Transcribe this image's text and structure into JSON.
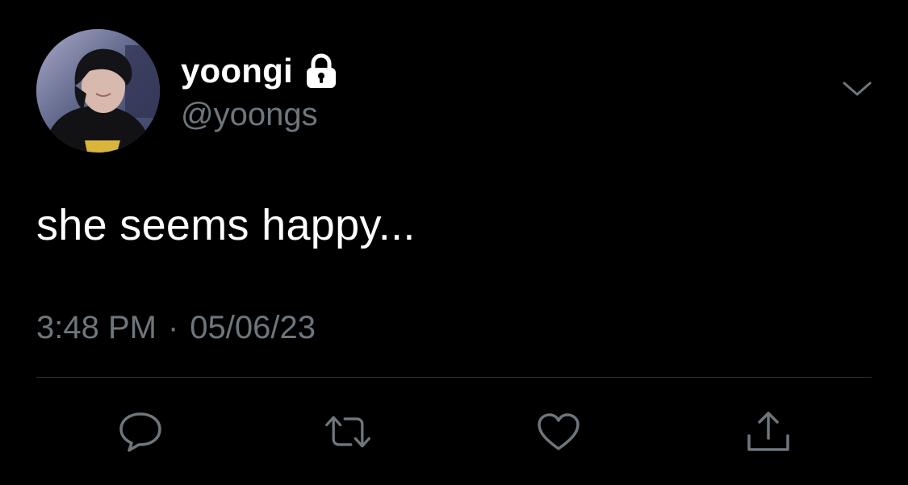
{
  "user": {
    "display_name": "yoongi",
    "handle": "@yoongs",
    "protected_icon": "lock-icon",
    "avatar": "profile-photo"
  },
  "tweet": {
    "text": "she seems happy...",
    "time": "3:48 PM",
    "separator": "·",
    "date": "05/06/23"
  },
  "menu": {
    "icon": "chevron-down-icon"
  },
  "actions": [
    {
      "name": "reply",
      "icon": "speech-bubble-icon"
    },
    {
      "name": "retweet",
      "icon": "retweet-arrows-icon"
    },
    {
      "name": "like",
      "icon": "heart-icon"
    },
    {
      "name": "share",
      "icon": "upload-icon"
    }
  ],
  "colors": {
    "background": "#000000",
    "primary_text": "#ffffff",
    "secondary_text": "#6e767d",
    "divider": "#2f3336"
  }
}
